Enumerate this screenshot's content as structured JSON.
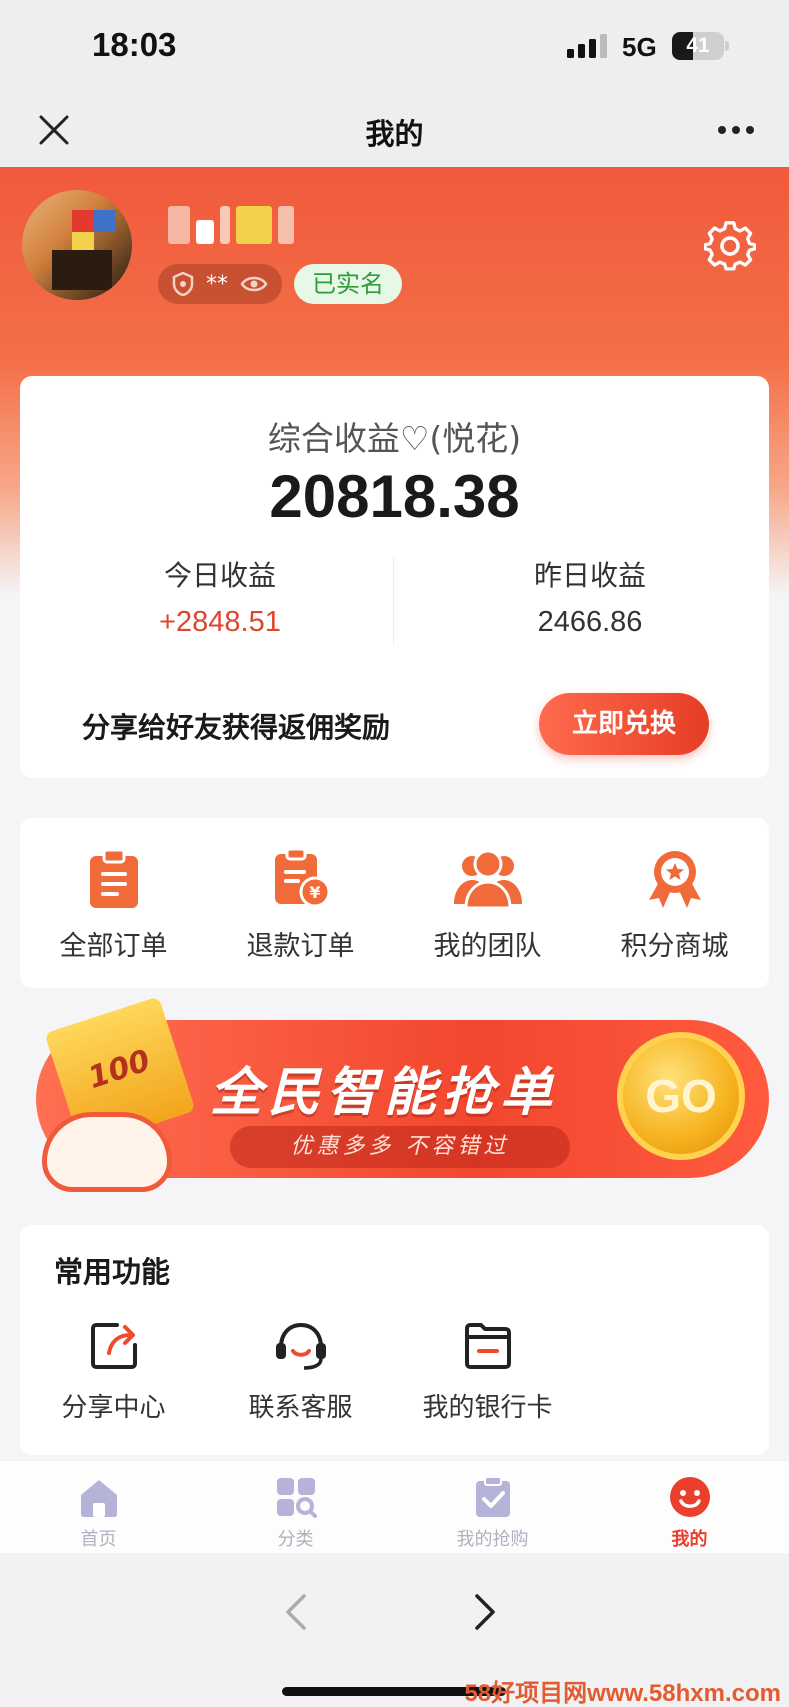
{
  "status_bar": {
    "time": "18:03",
    "network": "5G",
    "battery": "41",
    "battery_level": 0.41
  },
  "nav": {
    "title": "我的"
  },
  "profile": {
    "masked_id": "**",
    "verified_label": "已实名"
  },
  "earnings": {
    "label": "综合收益♡(悦花)",
    "total": "20818.38",
    "today_label": "今日收益",
    "today_value": "+2848.51",
    "yesterday_label": "昨日收益",
    "yesterday_value": "2466.86",
    "share_text": "分享给好友获得返佣奖励",
    "redeem_button": "立即兑换"
  },
  "orders": [
    {
      "label": "全部订单",
      "icon": "clipboard-icon"
    },
    {
      "label": "退款订单",
      "icon": "refund-icon"
    },
    {
      "label": "我的团队",
      "icon": "team-icon"
    },
    {
      "label": "积分商城",
      "icon": "medal-icon"
    }
  ],
  "banner": {
    "headline": "全民智能抢单",
    "subtitle": "优惠多多 不容错过",
    "go_label": "GO",
    "ticket_text": "100"
  },
  "common_functions": {
    "title": "常用功能",
    "items": [
      {
        "label": "分享中心",
        "icon": "share-icon"
      },
      {
        "label": "联系客服",
        "icon": "headset-icon"
      },
      {
        "label": "我的银行卡",
        "icon": "bank-card-icon"
      }
    ]
  },
  "tabbar": [
    {
      "label": "首页",
      "icon": "home-icon",
      "active": false
    },
    {
      "label": "分类",
      "icon": "category-icon",
      "active": false
    },
    {
      "label": "我的抢购",
      "icon": "purchase-icon",
      "active": false
    },
    {
      "label": "我的",
      "icon": "smile-icon",
      "active": true
    }
  ],
  "watermark": "58好项目网www.58hxm.com",
  "colors": {
    "accent": "#ea3f2a",
    "hero": "#f05a3c",
    "verify_green": "#2f9b3b"
  }
}
